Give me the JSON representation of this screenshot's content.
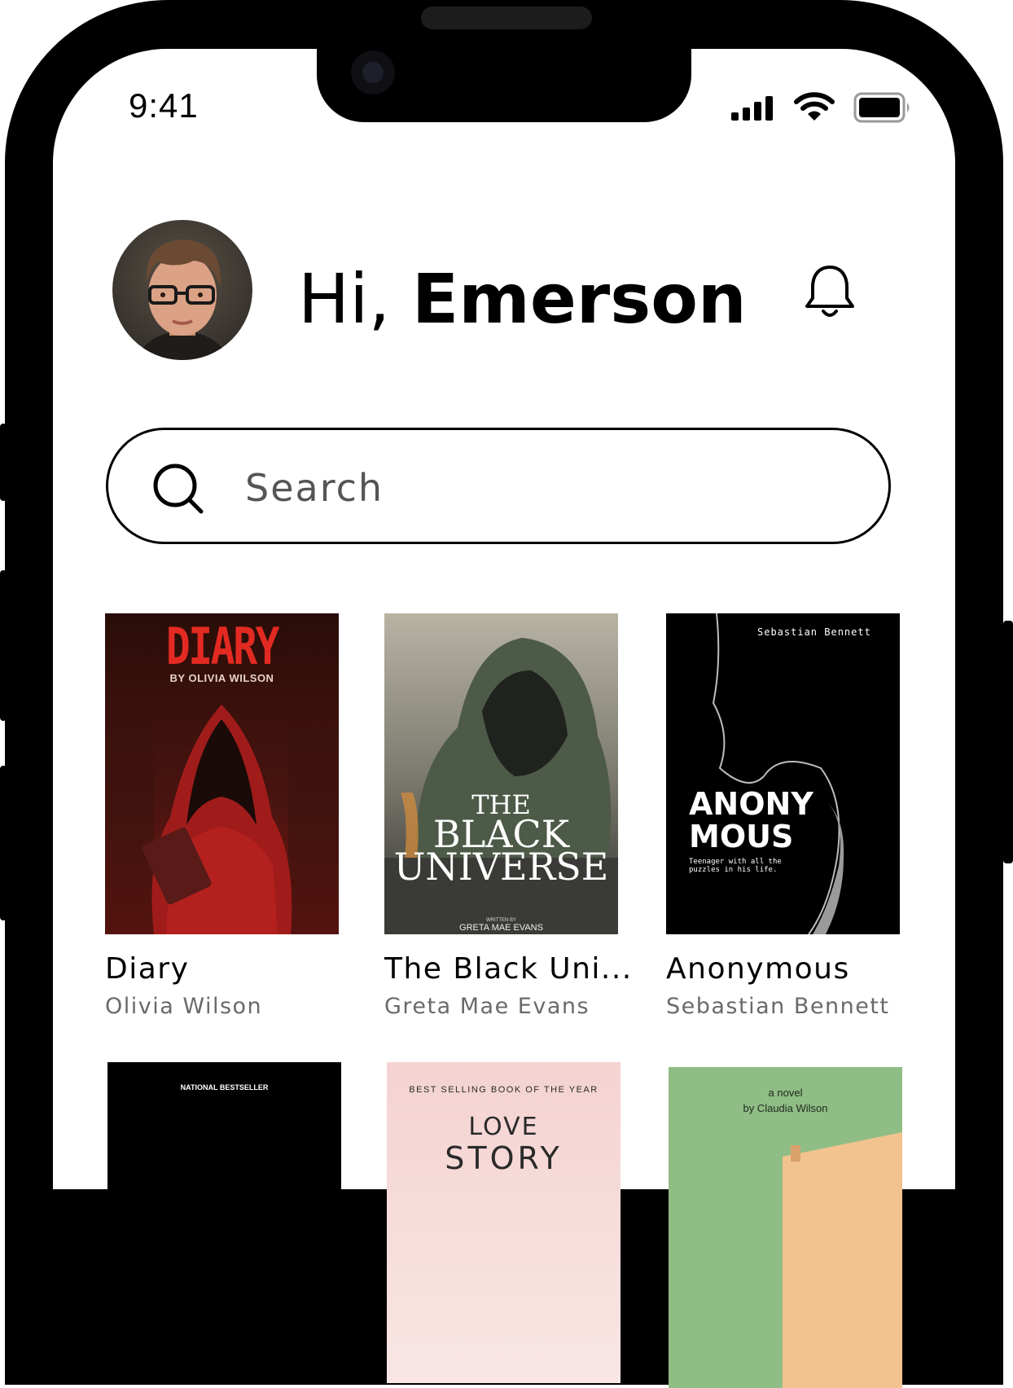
{
  "status_bar": {
    "time": "9:41"
  },
  "header": {
    "greeting_prefix": "Hi,",
    "user_name": "Emerson"
  },
  "search": {
    "placeholder": "Search"
  },
  "books": [
    {
      "title": "Diary",
      "author": "Olivia Wilson",
      "cover": {
        "title": "DIARY",
        "byline": "BY OLIVIA WILSON"
      }
    },
    {
      "title": "The Black Uni...",
      "author": "Greta Mae Evans",
      "cover": {
        "line1": "THE",
        "line2": "BLACK",
        "line3": "UNIVERSE",
        "written_by": "WRITTEN BY",
        "author": "GRETA MAE EVANS"
      }
    },
    {
      "title": "Anonymous",
      "author": "Sebastian Bennett",
      "cover": {
        "author": "Sebastian Bennett",
        "line1": "ANONY",
        "line2": "MOUS",
        "tagline": "Teenager with all the puzzles in his life."
      }
    }
  ],
  "books_row2": [
    {
      "cover": {
        "badge": "NATIONAL BESTSELLER"
      }
    },
    {
      "cover": {
        "badge": "BEST SELLING BOOK OF THE YEAR",
        "title": "LOVE",
        "title2": "STORY"
      }
    },
    {
      "cover": {
        "line1": "a novel",
        "line2": "by Claudia Wilson"
      }
    }
  ],
  "colors": {
    "accent": "#000000",
    "secondary_text": "#6a6a6a",
    "diary_red": "#e32a22"
  }
}
